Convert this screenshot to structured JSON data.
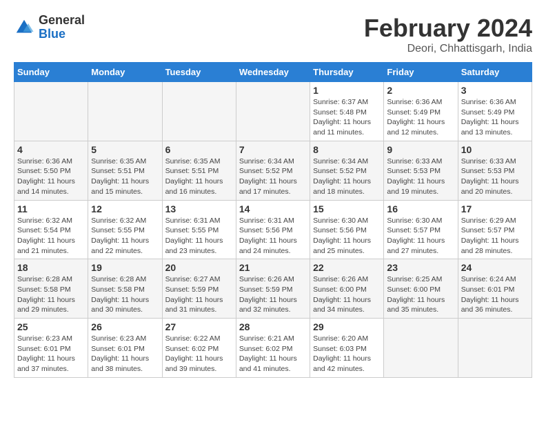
{
  "header": {
    "logo_general": "General",
    "logo_blue": "Blue",
    "title": "February 2024",
    "subtitle": "Deori, Chhattisgarh, India"
  },
  "weekdays": [
    "Sunday",
    "Monday",
    "Tuesday",
    "Wednesday",
    "Thursday",
    "Friday",
    "Saturday"
  ],
  "weeks": [
    [
      {
        "day": "",
        "info": ""
      },
      {
        "day": "",
        "info": ""
      },
      {
        "day": "",
        "info": ""
      },
      {
        "day": "",
        "info": ""
      },
      {
        "day": "1",
        "info": "Sunrise: 6:37 AM\nSunset: 5:48 PM\nDaylight: 11 hours\nand 11 minutes."
      },
      {
        "day": "2",
        "info": "Sunrise: 6:36 AM\nSunset: 5:49 PM\nDaylight: 11 hours\nand 12 minutes."
      },
      {
        "day": "3",
        "info": "Sunrise: 6:36 AM\nSunset: 5:49 PM\nDaylight: 11 hours\nand 13 minutes."
      }
    ],
    [
      {
        "day": "4",
        "info": "Sunrise: 6:36 AM\nSunset: 5:50 PM\nDaylight: 11 hours\nand 14 minutes."
      },
      {
        "day": "5",
        "info": "Sunrise: 6:35 AM\nSunset: 5:51 PM\nDaylight: 11 hours\nand 15 minutes."
      },
      {
        "day": "6",
        "info": "Sunrise: 6:35 AM\nSunset: 5:51 PM\nDaylight: 11 hours\nand 16 minutes."
      },
      {
        "day": "7",
        "info": "Sunrise: 6:34 AM\nSunset: 5:52 PM\nDaylight: 11 hours\nand 17 minutes."
      },
      {
        "day": "8",
        "info": "Sunrise: 6:34 AM\nSunset: 5:52 PM\nDaylight: 11 hours\nand 18 minutes."
      },
      {
        "day": "9",
        "info": "Sunrise: 6:33 AM\nSunset: 5:53 PM\nDaylight: 11 hours\nand 19 minutes."
      },
      {
        "day": "10",
        "info": "Sunrise: 6:33 AM\nSunset: 5:53 PM\nDaylight: 11 hours\nand 20 minutes."
      }
    ],
    [
      {
        "day": "11",
        "info": "Sunrise: 6:32 AM\nSunset: 5:54 PM\nDaylight: 11 hours\nand 21 minutes."
      },
      {
        "day": "12",
        "info": "Sunrise: 6:32 AM\nSunset: 5:55 PM\nDaylight: 11 hours\nand 22 minutes."
      },
      {
        "day": "13",
        "info": "Sunrise: 6:31 AM\nSunset: 5:55 PM\nDaylight: 11 hours\nand 23 minutes."
      },
      {
        "day": "14",
        "info": "Sunrise: 6:31 AM\nSunset: 5:56 PM\nDaylight: 11 hours\nand 24 minutes."
      },
      {
        "day": "15",
        "info": "Sunrise: 6:30 AM\nSunset: 5:56 PM\nDaylight: 11 hours\nand 25 minutes."
      },
      {
        "day": "16",
        "info": "Sunrise: 6:30 AM\nSunset: 5:57 PM\nDaylight: 11 hours\nand 27 minutes."
      },
      {
        "day": "17",
        "info": "Sunrise: 6:29 AM\nSunset: 5:57 PM\nDaylight: 11 hours\nand 28 minutes."
      }
    ],
    [
      {
        "day": "18",
        "info": "Sunrise: 6:28 AM\nSunset: 5:58 PM\nDaylight: 11 hours\nand 29 minutes."
      },
      {
        "day": "19",
        "info": "Sunrise: 6:28 AM\nSunset: 5:58 PM\nDaylight: 11 hours\nand 30 minutes."
      },
      {
        "day": "20",
        "info": "Sunrise: 6:27 AM\nSunset: 5:59 PM\nDaylight: 11 hours\nand 31 minutes."
      },
      {
        "day": "21",
        "info": "Sunrise: 6:26 AM\nSunset: 5:59 PM\nDaylight: 11 hours\nand 32 minutes."
      },
      {
        "day": "22",
        "info": "Sunrise: 6:26 AM\nSunset: 6:00 PM\nDaylight: 11 hours\nand 34 minutes."
      },
      {
        "day": "23",
        "info": "Sunrise: 6:25 AM\nSunset: 6:00 PM\nDaylight: 11 hours\nand 35 minutes."
      },
      {
        "day": "24",
        "info": "Sunrise: 6:24 AM\nSunset: 6:01 PM\nDaylight: 11 hours\nand 36 minutes."
      }
    ],
    [
      {
        "day": "25",
        "info": "Sunrise: 6:23 AM\nSunset: 6:01 PM\nDaylight: 11 hours\nand 37 minutes."
      },
      {
        "day": "26",
        "info": "Sunrise: 6:23 AM\nSunset: 6:01 PM\nDaylight: 11 hours\nand 38 minutes."
      },
      {
        "day": "27",
        "info": "Sunrise: 6:22 AM\nSunset: 6:02 PM\nDaylight: 11 hours\nand 39 minutes."
      },
      {
        "day": "28",
        "info": "Sunrise: 6:21 AM\nSunset: 6:02 PM\nDaylight: 11 hours\nand 41 minutes."
      },
      {
        "day": "29",
        "info": "Sunrise: 6:20 AM\nSunset: 6:03 PM\nDaylight: 11 hours\nand 42 minutes."
      },
      {
        "day": "",
        "info": ""
      },
      {
        "day": "",
        "info": ""
      }
    ]
  ]
}
